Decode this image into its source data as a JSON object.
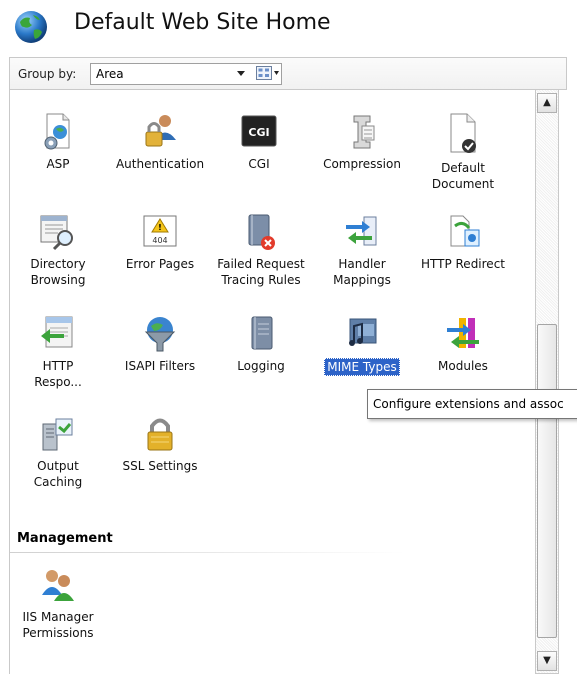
{
  "header": {
    "title": "Default Web Site Home",
    "icon": "globe-icon"
  },
  "toolbar": {
    "group_by_label": "Group by:",
    "group_by_value": "Area",
    "view_icon": "grid-view-icon"
  },
  "sections": [
    {
      "name": "",
      "items": [
        {
          "label": "ASP",
          "icon": "asp-icon"
        },
        {
          "label": "Authentication",
          "icon": "users-lock-icon"
        },
        {
          "label": "CGI",
          "icon": "cgi-icon",
          "icon_text": "CGI"
        },
        {
          "label": "Compression",
          "icon": "clamp-icon"
        },
        {
          "label": "Default Document",
          "icon": "document-check-icon"
        },
        {
          "label": "Directory Browsing",
          "icon": "directory-search-icon"
        },
        {
          "label": "Error Pages",
          "icon": "warning-icon",
          "icon_text": "404"
        },
        {
          "label": "Failed Request Tracing Rules",
          "icon": "notebook-error-icon"
        },
        {
          "label": "Handler Mappings",
          "icon": "arrows-mapping-icon"
        },
        {
          "label": "HTTP Redirect",
          "icon": "redirect-icon"
        },
        {
          "label": "HTTP Respo...",
          "icon": "http-response-icon"
        },
        {
          "label": "ISAPI Filters",
          "icon": "funnel-icon"
        },
        {
          "label": "Logging",
          "icon": "logbook-icon"
        },
        {
          "label": "MIME Types",
          "icon": "music-video-icon",
          "selected": true
        },
        {
          "label": "Modules",
          "icon": "modules-icon"
        },
        {
          "label": "Output Caching",
          "icon": "server-cache-icon"
        },
        {
          "label": "SSL Settings",
          "icon": "padlock-icon"
        }
      ]
    },
    {
      "name": "Management",
      "items": [
        {
          "label": "IIS Manager Permissions",
          "icon": "users-icon"
        }
      ]
    }
  ],
  "tooltip": {
    "text": "Configure extensions and assoc"
  },
  "scrollbar": {
    "up_glyph": "▲",
    "down_glyph": "▼"
  },
  "colors": {
    "selection": "#2d63c8",
    "accent_blue": "#2f7fd3",
    "accent_green": "#3ca33c"
  }
}
